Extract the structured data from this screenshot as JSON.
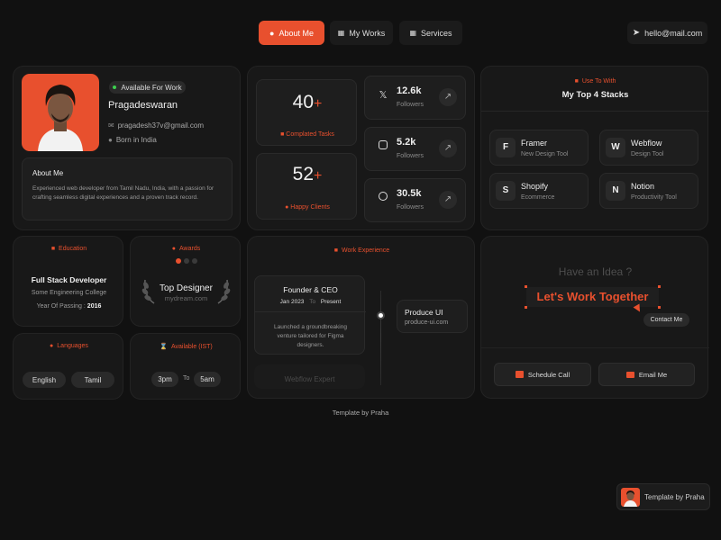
{
  "nav": {
    "about_label": "About Me",
    "works_label": "My Works",
    "services_label": "Services",
    "email_label": "hello@mail.com"
  },
  "profile": {
    "status": "Available For Work",
    "name": "Pragadeswaran",
    "email": "pragadesh37v@gmail.com",
    "location": "Born in India",
    "about_title": "About Me",
    "about_text": "Experienced web developer from Tamil Nadu, India, with a passion for crafting seamless digital experiences and a proven track record."
  },
  "stats": {
    "tasks_value": "40",
    "tasks_plus": "+",
    "tasks_label": "Complated Tasks",
    "clients_value": "52",
    "clients_plus": "+",
    "clients_label": "Happy Clients"
  },
  "socials": [
    {
      "icon": "x-icon",
      "count": "12.6k",
      "label": "Followers"
    },
    {
      "icon": "instagram-icon",
      "count": "5.2k",
      "label": "Followers"
    },
    {
      "icon": "dribbble-icon",
      "count": "30.5k",
      "label": "Followers"
    }
  ],
  "stacks": {
    "eyebrow": "Use To With",
    "title": "My Top 4 Stacks",
    "items": [
      {
        "name": "Framer",
        "desc": "New Design Tool",
        "icon": "framer-icon"
      },
      {
        "name": "Webflow",
        "desc": "Design Tool",
        "icon": "webflow-icon"
      },
      {
        "name": "Shopify",
        "desc": "Ecommerce",
        "icon": "shopify-icon"
      },
      {
        "name": "Notion",
        "desc": "Productivity Tool",
        "icon": "notion-icon"
      }
    ]
  },
  "education": {
    "title": "Education",
    "degree": "Full Stack Developer",
    "school": "Some Engineering College",
    "year_label": "Year Of Passing :",
    "year": "2016"
  },
  "awards": {
    "title": "Awards",
    "award": "Top Designer",
    "site": "mydream.com"
  },
  "work": {
    "title": "Work Experience",
    "role": "Founder & CEO",
    "from": "Jan 2023",
    "to_label": "To",
    "to": "Present",
    "desc": "Launched a groundbreaking venture tailored for Figma designers.",
    "next_role": "Webflow Expert",
    "company": "Produce UI",
    "company_site": "produce-ui.com"
  },
  "cta": {
    "question": "Have an Idea ?",
    "headline": "Let's Work Together",
    "contact": "Contact Me",
    "schedule": "Schedule Call",
    "email": "Email Me"
  },
  "languages": {
    "title": "Languages",
    "items": [
      "English",
      "Tamil"
    ]
  },
  "availability": {
    "title": "Available (IST)",
    "from": "3pm",
    "to_label": "To",
    "to": "5am"
  },
  "footer": {
    "credit": "Template by Praha",
    "badge": "Template by Praha"
  },
  "colors": {
    "accent": "#e8502e",
    "background": "#111111",
    "card": "#181818"
  }
}
